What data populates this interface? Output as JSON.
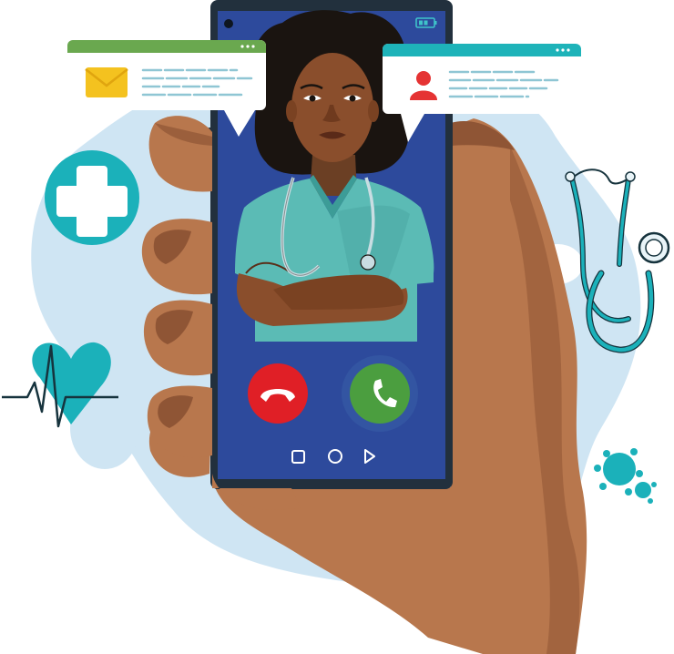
{
  "illustration": {
    "subject": "telemedicine-video-call",
    "icons": {
      "message": "envelope-icon",
      "contact": "user-icon",
      "medical": "medical-cross-icon",
      "heart": "heartbeat-icon",
      "stethoscope": "stethoscope-icon",
      "virus": "virus-icon",
      "decline": "phone-decline-icon",
      "accept": "phone-accept-icon",
      "nav_square": "nav-square-icon",
      "nav_circle": "nav-circle-icon",
      "nav_back": "nav-back-icon",
      "battery": "battery-icon",
      "camera": "front-camera-icon"
    },
    "colors": {
      "background_blob": "#cfe5f3",
      "screen": "#2d4a9c",
      "phone_frame": "#22303d",
      "skin": "#b8774d",
      "skin_shadow": "#8f5535",
      "skin_light": "#cf8f62",
      "teal": "#1bb1ba",
      "scrubs": "#5bbbb5",
      "message_bar": "#6aa84f",
      "contact_bar": "#1eb3b9",
      "envelope": "#f4c21f",
      "user": "#e53333",
      "decline": "#e01f26",
      "accept": "#4b9e3f",
      "placeholder_lines": "#8fc6d4"
    }
  }
}
